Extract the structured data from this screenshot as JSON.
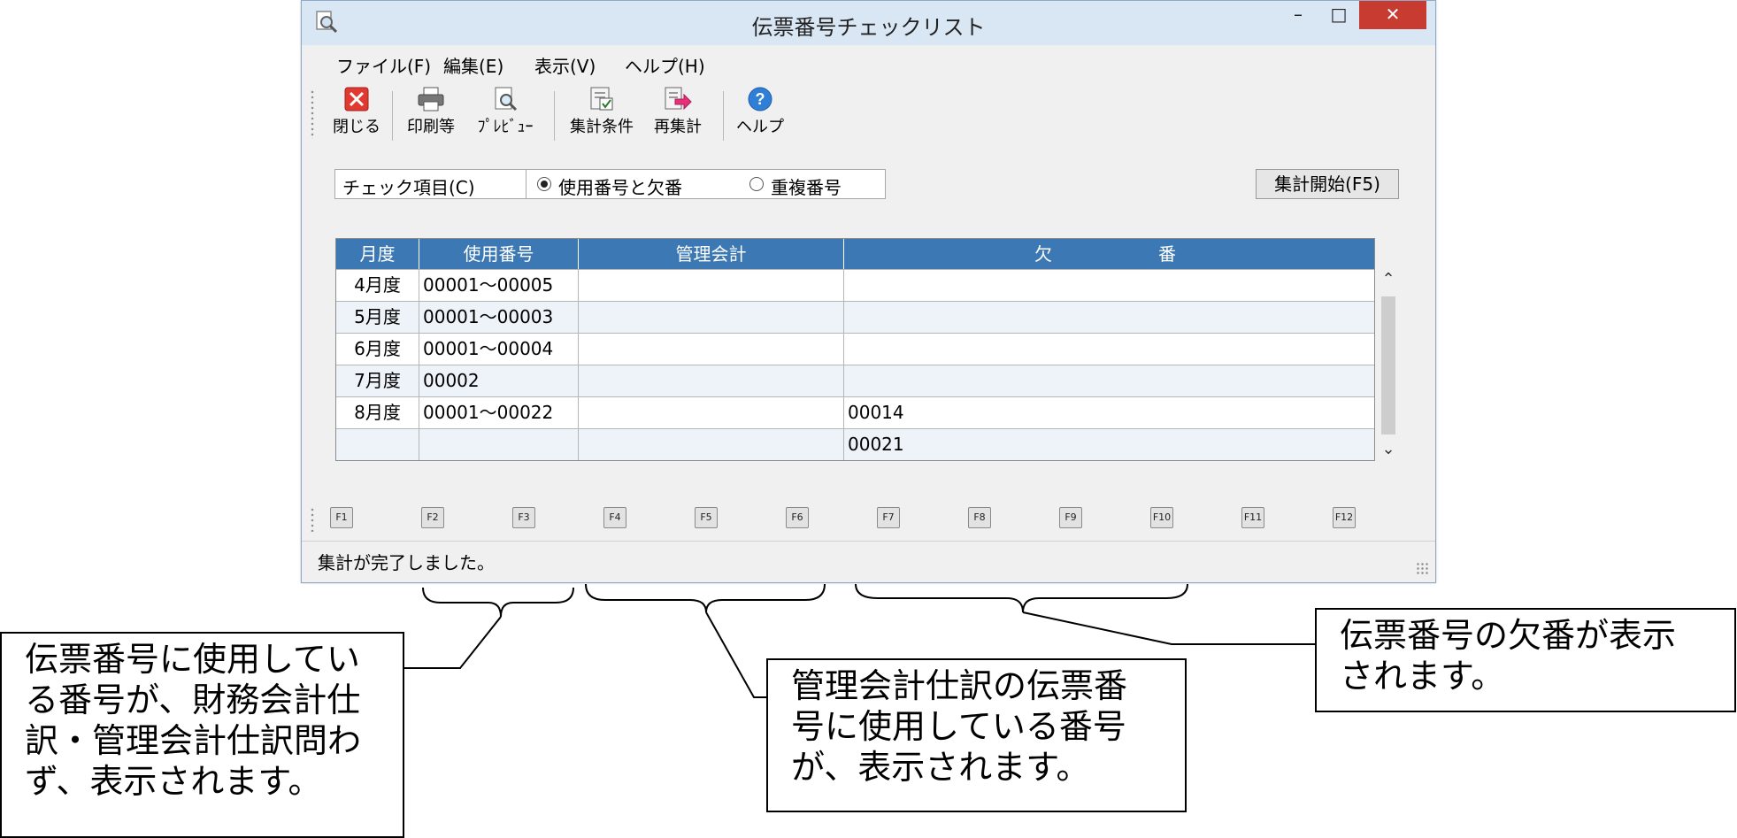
{
  "window": {
    "title": "伝票番号チェックリスト",
    "minimize": "–",
    "maximize": "□",
    "close": "✕"
  },
  "menu": {
    "file": "ファイル(F)",
    "edit": "編集(E)",
    "view": "表示(V)",
    "help": "ヘルプ(H)"
  },
  "toolbar": {
    "close": "閉じる",
    "print": "印刷等",
    "preview": "ﾌﾟﾚﾋﾞｭｰ",
    "conditions": "集計条件",
    "recalc": "再集計",
    "help": "ヘルプ"
  },
  "check": {
    "label": "チェック項目(C)",
    "option_used": "使用番号と欠番",
    "option_duplicate": "重複番号",
    "selected": "使用番号と欠番"
  },
  "start_button": "集計開始(F5)",
  "grid": {
    "headers": {
      "month": "月度",
      "used": "使用番号",
      "management": "管理会計",
      "missing": "欠　　　　　　番"
    },
    "rows": [
      {
        "month": "4月度",
        "used": "00001～00005",
        "management": "",
        "missing": ""
      },
      {
        "month": "5月度",
        "used": "00001～00003",
        "management": "",
        "missing": ""
      },
      {
        "month": "6月度",
        "used": "00001～00004",
        "management": "",
        "missing": ""
      },
      {
        "month": "7月度",
        "used": "00002",
        "management": "",
        "missing": ""
      },
      {
        "month": "8月度",
        "used": "00001～00022",
        "management": "",
        "missing": "00014"
      },
      {
        "month": "",
        "used": "",
        "management": "",
        "missing": "00021"
      }
    ]
  },
  "fkeys": [
    "F1",
    "F2",
    "F3",
    "F4",
    "F5",
    "F6",
    "F7",
    "F8",
    "F9",
    "F10",
    "F11",
    "F12"
  ],
  "status": "集計が完了しました。",
  "callouts": {
    "used": [
      "伝票番号に使用してい",
      "る番号が、財務会計仕",
      "訳・管理会計仕訳問わ",
      "ず、表示されます。"
    ],
    "management": [
      "管理会計仕訳の伝票番",
      "号に使用している番号",
      "が、表示されます。"
    ],
    "missing": [
      "伝票番号の欠番が表示",
      "されます。"
    ]
  },
  "colors": {
    "grid_header": "#3b78b4",
    "close_button": "#c83b30",
    "title_bar": "#d9e6f4"
  }
}
